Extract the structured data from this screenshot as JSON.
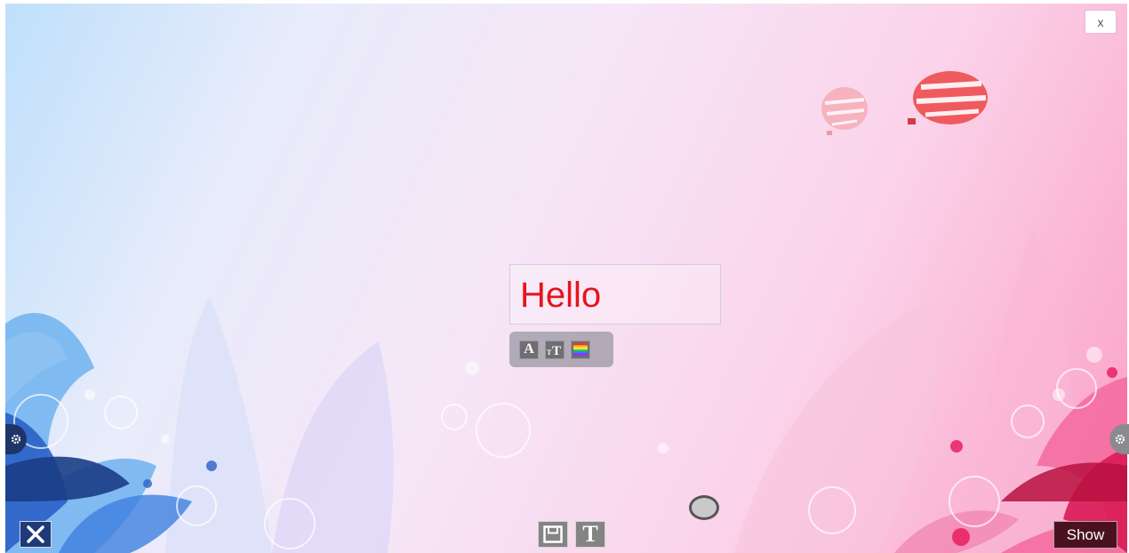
{
  "canvas": {
    "text_content": "Hello",
    "text_color": "#e5141c"
  },
  "header": {
    "close_label": "x"
  },
  "format_toolbar": {
    "font_icon": "font-face-icon",
    "font_label": "A",
    "size_icon": "font-size-icon",
    "color_icon": "color-palette-icon"
  },
  "bottom_bar": {
    "exit_icon": "close-icon",
    "save_icon": "save-icon",
    "text_tool_icon": "text-tool-icon",
    "text_tool_label": "T",
    "show_label": "Show"
  },
  "side_controls": {
    "left_icon": "gear-icon",
    "right_icon": "gear-icon"
  },
  "decoration": {
    "balloon_icon": "hot-air-balloon-icon"
  },
  "colors": {
    "text": "#e5141c",
    "bg_left": "#bfe0fb",
    "bg_right": "#fb9fc4",
    "exit_button": "#1e3a78",
    "show_button": "#4a1220"
  }
}
